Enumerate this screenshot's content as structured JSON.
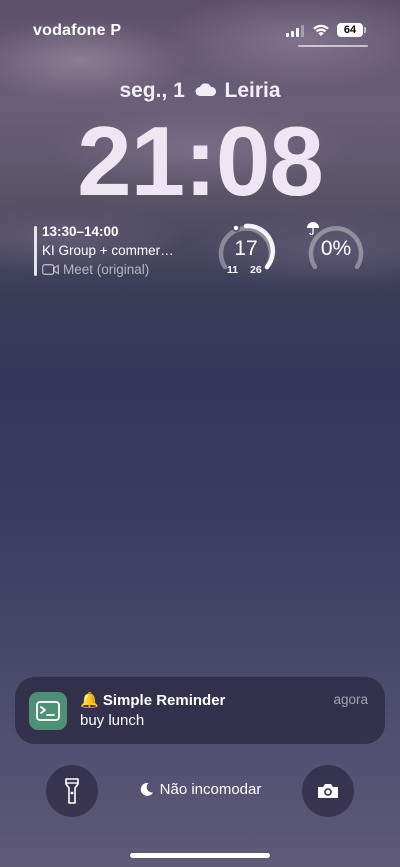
{
  "status_bar": {
    "carrier": "vodafone P",
    "battery_level": "64",
    "signal_bars": 3,
    "icons": [
      "signal-icon",
      "wifi-icon",
      "battery-icon"
    ]
  },
  "lock_screen": {
    "date": "seg., 1",
    "weather_location": "Leiria",
    "weather_icon": "cloud-icon",
    "time": "21:08"
  },
  "widgets": {
    "calendar_event": {
      "time_range": "13:30–14:00",
      "title": "KI Group + commer…",
      "location": "Meet (original)",
      "location_icon": "video-camera-icon"
    },
    "temperature": {
      "current": "17",
      "low": "11",
      "high": "26"
    },
    "rain_chance": {
      "value": "0%",
      "icon": "umbrella-icon",
      "fraction": 0
    }
  },
  "notification": {
    "app_icon": "terminal-icon",
    "emoji": "🔔",
    "title": "Simple Reminder",
    "body": "buy lunch",
    "time": "agora",
    "app_icon_color": "#4f8f78"
  },
  "bottom_bar": {
    "flashlight_icon": "flashlight-icon",
    "focus_mode": "Não incomodar",
    "focus_icon": "moon-icon",
    "camera_icon": "camera-icon"
  }
}
